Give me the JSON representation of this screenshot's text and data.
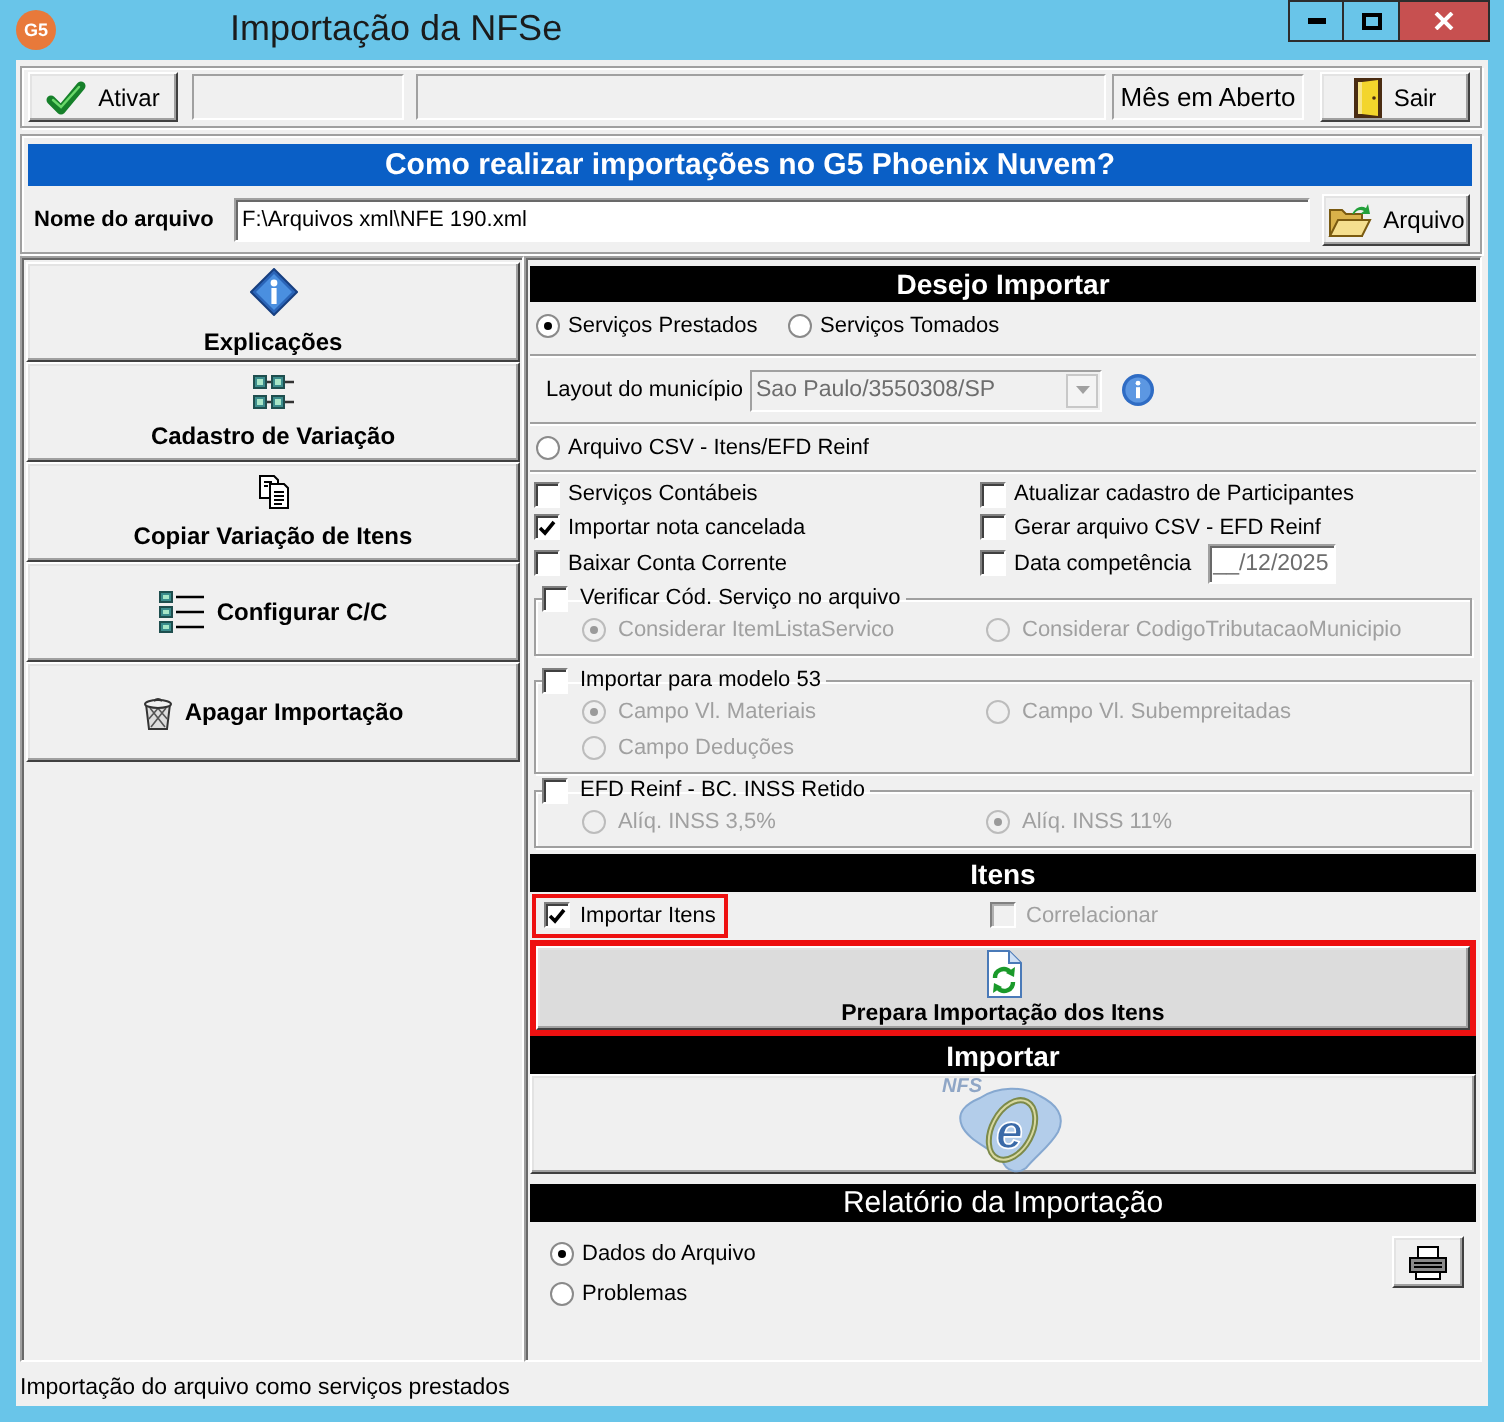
{
  "window": {
    "app_badge": "G5",
    "title": "Importação da NFSe"
  },
  "toolbar": {
    "activate_button": "Ativar",
    "period_status": "Mês em Aberto",
    "exit_button": "Sair"
  },
  "help_banner": "Como realizar importações no G5 Phoenix Nuvem?",
  "file": {
    "label": "Nome do arquivo",
    "value": "F:\\Arquivos xml\\NFE 190.xml",
    "browse_button": "Arquivo"
  },
  "sidebar": {
    "items": [
      {
        "label": "Explicações",
        "kind": "stacked"
      },
      {
        "label": "Cadastro de Variação",
        "kind": "stacked"
      },
      {
        "label": "Copiar Variação de Itens",
        "kind": "stacked"
      },
      {
        "label": "Configurar C/C",
        "kind": "inline"
      },
      {
        "label": "Apagar Importação",
        "kind": "inline"
      }
    ]
  },
  "import_options": {
    "title": "Desejo Importar",
    "service_types": [
      {
        "label": "Serviços Prestados",
        "selected": true
      },
      {
        "label": "Serviços Tomados",
        "selected": false
      }
    ],
    "layout": {
      "label": "Layout do município",
      "value": "Sao Paulo/3550308/SP",
      "disabled": true
    },
    "csv_option": {
      "label": "Arquivo CSV - Itens/EFD Reinf",
      "selected": false
    },
    "checkboxes": [
      {
        "label": "Serviços Contábeis",
        "checked": false,
        "kind": "plain"
      },
      {
        "label": "Atualizar cadastro de Participantes",
        "checked": false,
        "kind": "plain"
      },
      {
        "label": "Importar nota cancelada",
        "checked": true,
        "kind": "plain"
      },
      {
        "label": "Gerar arquivo CSV - EFD Reinf",
        "checked": false,
        "kind": "plain"
      },
      {
        "label": "Baixar Conta Corrente",
        "checked": false,
        "kind": "plain"
      },
      {
        "label": "Data competência",
        "checked": false,
        "kind": "date",
        "value": "__/12/2025"
      }
    ],
    "groups": [
      {
        "label": "Verificar Cód. Serviço no arquivo",
        "checked": false,
        "options": [
          {
            "label": "Considerar ItemListaServico",
            "selected": true,
            "disabled": true
          },
          {
            "label": "Considerar CodigoTributacaoMunicipio",
            "selected": false,
            "disabled": true
          }
        ]
      },
      {
        "label": "Importar para modelo 53",
        "checked": false,
        "options": [
          {
            "label": "Campo Vl. Materiais",
            "selected": true,
            "disabled": true
          },
          {
            "label": "Campo Vl. Subempreitadas",
            "selected": false,
            "disabled": true
          },
          {
            "label": "Campo Deduções",
            "selected": false,
            "disabled": true
          }
        ]
      },
      {
        "label": "EFD Reinf - BC. INSS Retido",
        "checked": false,
        "options": [
          {
            "label": "Alíq. INSS 3,5%",
            "selected": false,
            "disabled": true
          },
          {
            "label": "Alíq. INSS 11%",
            "selected": true,
            "disabled": true
          }
        ]
      }
    ]
  },
  "items_section": {
    "title": "Itens",
    "checkboxes": [
      {
        "label": "Importar Itens",
        "checked": true,
        "disabled": false,
        "highlighted": true
      },
      {
        "label": "Correlacionar",
        "checked": false,
        "disabled": true,
        "highlighted": false
      }
    ],
    "prepare_button": {
      "label": "Prepara Importação dos Itens",
      "highlighted": true
    }
  },
  "import_section": {
    "title": "Importar",
    "logo": {
      "prefix": "NFS",
      "letter": "e"
    }
  },
  "report_section": {
    "title": "Relatório da Importação",
    "options": [
      {
        "label": "Dados do Arquivo",
        "selected": true
      },
      {
        "label": "Problemas",
        "selected": false
      }
    ]
  },
  "status_bar": "Importação do arquivo como serviços prestados"
}
